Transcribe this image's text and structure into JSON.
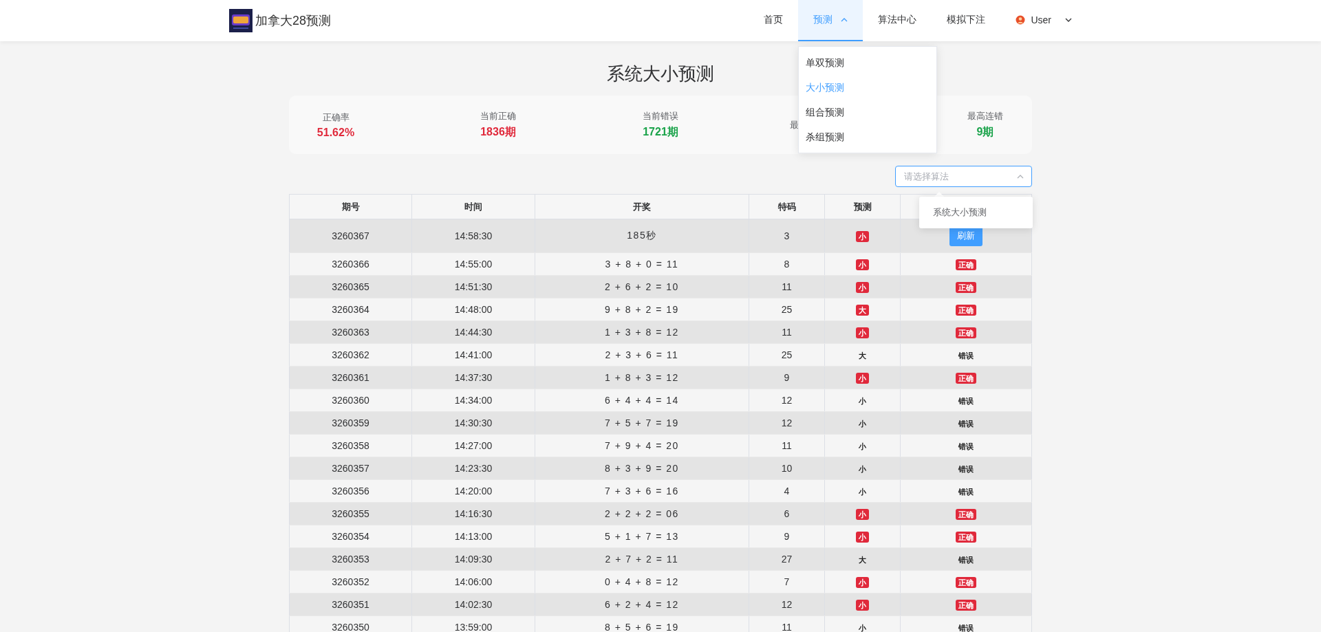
{
  "header": {
    "brand": "加拿大28预测",
    "nav": [
      {
        "label": "首页",
        "selected": false,
        "kind": "link"
      },
      {
        "label": "预测",
        "selected": true,
        "kind": "dropdown"
      },
      {
        "label": "算法中心",
        "selected": false,
        "kind": "link"
      },
      {
        "label": "模拟下注",
        "selected": false,
        "kind": "link"
      },
      {
        "label": "User",
        "selected": false,
        "kind": "user"
      }
    ],
    "menu": [
      {
        "label": "单双预测",
        "selected": false
      },
      {
        "label": "大小预测",
        "selected": true
      },
      {
        "label": "组合预测",
        "selected": false
      },
      {
        "label": "杀组预测",
        "selected": false
      }
    ]
  },
  "title": "系统大小预测",
  "stats": [
    {
      "label": "正确率",
      "value": "51.62%",
      "color": "#e0293b"
    },
    {
      "label": "当前正确",
      "value": "1836期",
      "color": "#e0293b"
    },
    {
      "label": "当前错误",
      "value": "1721期",
      "color": "#1aa34a"
    },
    {
      "label": "最"
    },
    {
      "label": "最高连错",
      "value": "9期",
      "color": "#1aa34a"
    }
  ],
  "select": {
    "placeholder": "请选择算法",
    "options": [
      "系统大小预测"
    ]
  },
  "table": {
    "columns": [
      "期号",
      "时间",
      "开奖",
      "特码",
      "预测"
    ],
    "rows": [
      {
        "kind": "pending",
        "issue": "3260367",
        "time": "14:58:30",
        "draw": "185秒",
        "code": "3",
        "prediction": {
          "text": "小",
          "highlighted": true
        },
        "action": "刷新"
      },
      {
        "kind": "settled",
        "issue": "3260366",
        "time": "14:55:00",
        "draw": "3 + 8 + 0 = 11",
        "code": "8",
        "prediction": {
          "text": "小",
          "highlighted": true
        },
        "result": {
          "text": "正确",
          "correct": true
        }
      },
      {
        "kind": "settled",
        "issue": "3260365",
        "time": "14:51:30",
        "draw": "2 + 6 + 2 = 10",
        "code": "11",
        "prediction": {
          "text": "小",
          "highlighted": true
        },
        "result": {
          "text": "正确",
          "correct": true
        }
      },
      {
        "kind": "settled",
        "issue": "3260364",
        "time": "14:48:00",
        "draw": "9 + 8 + 2 = 19",
        "code": "25",
        "prediction": {
          "text": "大",
          "highlighted": true
        },
        "result": {
          "text": "正确",
          "correct": true
        }
      },
      {
        "kind": "settled",
        "issue": "3260363",
        "time": "14:44:30",
        "draw": "1 + 3 + 8 = 12",
        "code": "11",
        "prediction": {
          "text": "小",
          "highlighted": true
        },
        "result": {
          "text": "正确",
          "correct": true
        }
      },
      {
        "kind": "settled",
        "issue": "3260362",
        "time": "14:41:00",
        "draw": "2 + 3 + 6 = 11",
        "code": "25",
        "prediction": {
          "text": "大",
          "highlighted": false
        },
        "result": {
          "text": "错误",
          "correct": false
        }
      },
      {
        "kind": "settled",
        "issue": "3260361",
        "time": "14:37:30",
        "draw": "1 + 8 + 3 = 12",
        "code": "9",
        "prediction": {
          "text": "小",
          "highlighted": true
        },
        "result": {
          "text": "正确",
          "correct": true
        }
      },
      {
        "kind": "settled",
        "issue": "3260360",
        "time": "14:34:00",
        "draw": "6 + 4 + 4 = 14",
        "code": "12",
        "prediction": {
          "text": "小",
          "highlighted": false
        },
        "result": {
          "text": "错误",
          "correct": false
        }
      },
      {
        "kind": "settled",
        "issue": "3260359",
        "time": "14:30:30",
        "draw": "7 + 5 + 7 = 19",
        "code": "12",
        "prediction": {
          "text": "小",
          "highlighted": false
        },
        "result": {
          "text": "错误",
          "correct": false
        }
      },
      {
        "kind": "settled",
        "issue": "3260358",
        "time": "14:27:00",
        "draw": "7 + 9 + 4 = 20",
        "code": "11",
        "prediction": {
          "text": "小",
          "highlighted": false
        },
        "result": {
          "text": "错误",
          "correct": false
        }
      },
      {
        "kind": "settled",
        "issue": "3260357",
        "time": "14:23:30",
        "draw": "8 + 3 + 9 = 20",
        "code": "10",
        "prediction": {
          "text": "小",
          "highlighted": false
        },
        "result": {
          "text": "错误",
          "correct": false
        }
      },
      {
        "kind": "settled",
        "issue": "3260356",
        "time": "14:20:00",
        "draw": "7 + 3 + 6 = 16",
        "code": "4",
        "prediction": {
          "text": "小",
          "highlighted": false
        },
        "result": {
          "text": "错误",
          "correct": false
        }
      },
      {
        "kind": "settled",
        "issue": "3260355",
        "time": "14:16:30",
        "draw": "2 + 2 + 2 = 06",
        "code": "6",
        "prediction": {
          "text": "小",
          "highlighted": true
        },
        "result": {
          "text": "正确",
          "correct": true
        }
      },
      {
        "kind": "settled",
        "issue": "3260354",
        "time": "14:13:00",
        "draw": "5 + 1 + 7 = 13",
        "code": "9",
        "prediction": {
          "text": "小",
          "highlighted": true
        },
        "result": {
          "text": "正确",
          "correct": true
        }
      },
      {
        "kind": "settled",
        "issue": "3260353",
        "time": "14:09:30",
        "draw": "2 + 7 + 2 = 11",
        "code": "27",
        "prediction": {
          "text": "大",
          "highlighted": false
        },
        "result": {
          "text": "错误",
          "correct": false
        }
      },
      {
        "kind": "settled",
        "issue": "3260352",
        "time": "14:06:00",
        "draw": "0 + 4 + 8 = 12",
        "code": "7",
        "prediction": {
          "text": "小",
          "highlighted": true
        },
        "result": {
          "text": "正确",
          "correct": true
        }
      },
      {
        "kind": "settled",
        "issue": "3260351",
        "time": "14:02:30",
        "draw": "6 + 2 + 4 = 12",
        "code": "12",
        "prediction": {
          "text": "小",
          "highlighted": true
        },
        "result": {
          "text": "正确",
          "correct": true
        }
      },
      {
        "kind": "settled",
        "issue": "3260350",
        "time": "13:59:00",
        "draw": "8 + 5 + 6 = 19",
        "code": "11",
        "prediction": {
          "text": "小",
          "highlighted": false
        },
        "result": {
          "text": "错误",
          "correct": false
        }
      }
    ]
  }
}
